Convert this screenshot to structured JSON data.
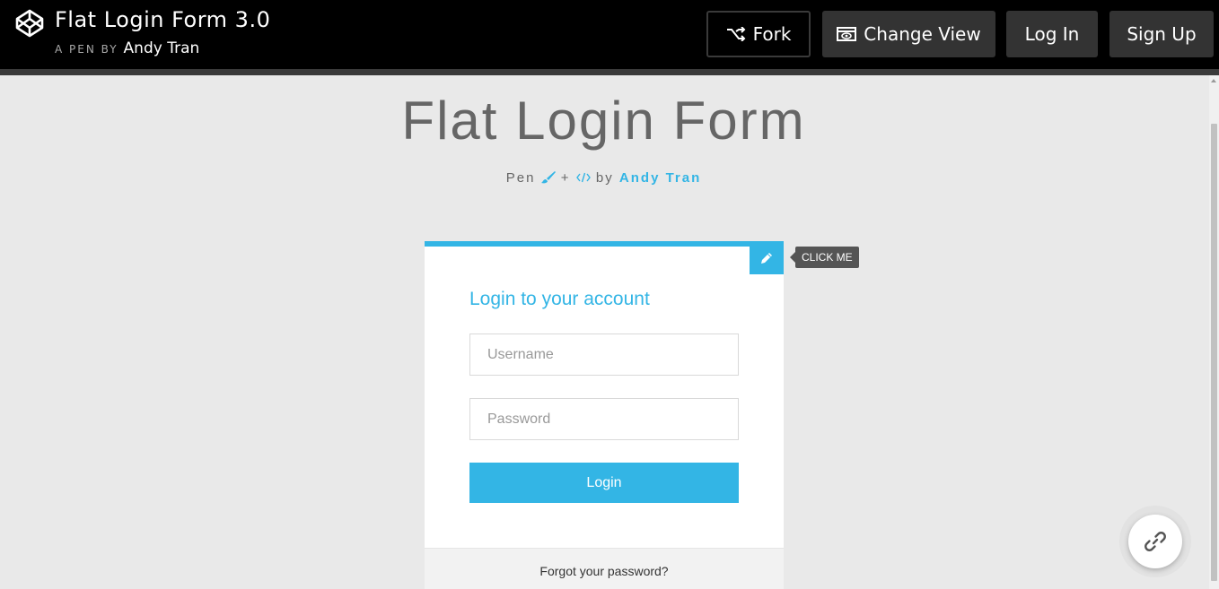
{
  "header": {
    "logo_icon": "codepen-logo-icon",
    "pen_title": "Flat Login Form 3.0",
    "pen_by_prefix": "A PEN BY",
    "author": "Andy Tran",
    "buttons": {
      "fork": "Fork",
      "change_view": "Change View",
      "log_in": "Log In",
      "sign_up": "Sign Up"
    }
  },
  "page": {
    "title": "Flat Login Form",
    "subline": {
      "pen": "Pen",
      "plus": "+",
      "by": "by",
      "author": "Andy Tran"
    }
  },
  "card": {
    "toggle_icon": "pencil-icon",
    "tooltip": "CLICK ME",
    "title": "Login to your account",
    "username_placeholder": "Username",
    "password_placeholder": "Password",
    "submit_label": "Login",
    "forgot_label": "Forgot your password?"
  },
  "fab": {
    "icon": "link-icon"
  },
  "colors": {
    "accent": "#33b5e5",
    "header_bg": "#000000",
    "page_bg": "#e9e9e9"
  }
}
